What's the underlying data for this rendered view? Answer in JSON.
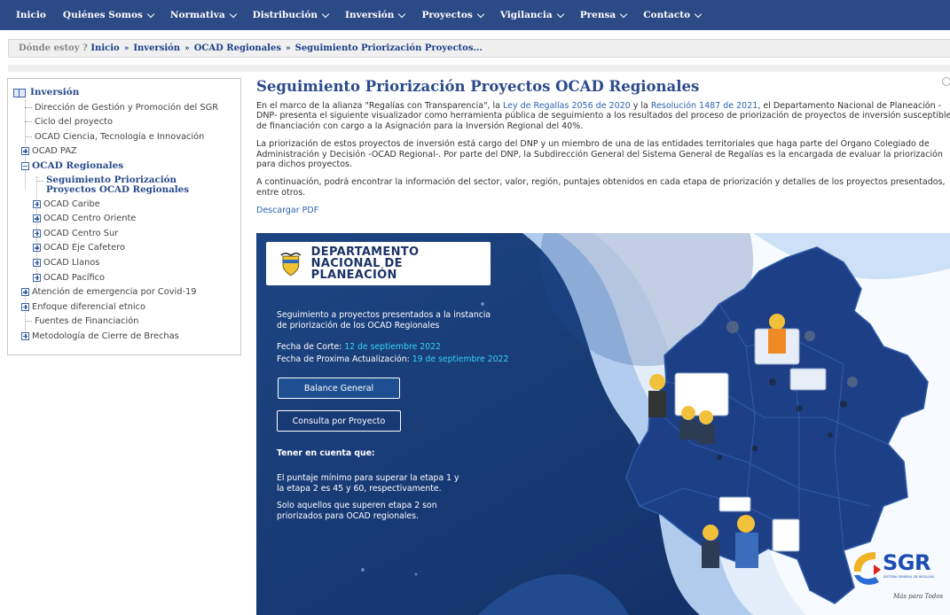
{
  "topnav": {
    "items": [
      {
        "label": "Inicio",
        "dropdown": false
      },
      {
        "label": "Quiénes Somos",
        "dropdown": true
      },
      {
        "label": "Normativa",
        "dropdown": true
      },
      {
        "label": "Distribución",
        "dropdown": true
      },
      {
        "label": "Inversión",
        "dropdown": true
      },
      {
        "label": "Proyectos",
        "dropdown": true
      },
      {
        "label": "Vigilancia",
        "dropdown": true
      },
      {
        "label": "Prensa",
        "dropdown": true
      },
      {
        "label": "Contacto",
        "dropdown": true
      }
    ],
    "bg_color": "#2b4a86"
  },
  "breadcrumb": {
    "prefix": "Dónde estoy ?",
    "items": [
      "Inicio",
      "Inversión",
      "OCAD Regionales",
      "Seguimiento Priorización Proyectos..."
    ]
  },
  "sidebar": {
    "root": "Inversión",
    "items": [
      {
        "label": "Dirección de Gestión y Promoción del SGR"
      },
      {
        "label": "Ciclo del proyecto"
      },
      {
        "label": "OCAD Ciencia, Tecnología e Innovación"
      },
      {
        "label": "OCAD PAZ"
      },
      {
        "label": "OCAD Regionales"
      },
      {
        "label": "Seguimiento Priorización Proyectos OCAD Regionales"
      },
      {
        "label": "OCAD Caribe"
      },
      {
        "label": "OCAD Centro Oriente"
      },
      {
        "label": "OCAD Centro Sur"
      },
      {
        "label": "OCAD Eje Cafetero"
      },
      {
        "label": "OCAD Llanos"
      },
      {
        "label": "OCAD Pacífico"
      },
      {
        "label": "Atención de emergencia por Covid-19"
      },
      {
        "label": "Enfoque diferencial etnico"
      },
      {
        "label": "Fuentes de Financiación"
      },
      {
        "label": "Metodología de Cierre de Brechas"
      }
    ]
  },
  "main": {
    "title": "Seguimiento Priorización Proyectos OCAD Regionales",
    "p1": {
      "a": "En el marco de la alianza \"Regalías con Transparencia\", la ",
      "link1": "Ley de Regalías 2056 de 2020",
      "b": " y la ",
      "link2": "Resolución 1487 de 2021",
      "c": ", el Departamento Nacional de Planeación -DNP- presenta el siguiente visualizador como herramienta pública de seguimiento a los resultados del proceso de priorización de proyectos de inversión susceptibles de financiación con cargo a la Asignación para la Inversión Regional del 40%."
    },
    "p2": "La priorización de estos proyectos de inversión está cargo del DNP y un miembro de una de las entidades territoriales que haga parte del Órgano Colegiado de Administración y Decisión -OCAD Regional-. Por parte del DNP, la Subdirección General del Sistema General de Regalías es la encargada de evaluar la priorización para dichos proyectos.",
    "p3": "A continuación, podrá encontrar la información del sector, valor, región, puntajes obtenidos en cada etapa de priorización y detalles de los proyectos presentados, entre otros.",
    "download": "Descargar PDF"
  },
  "banner": {
    "logo_line1": "DEPARTAMENTO",
    "logo_line2": "NACIONAL DE PLANEACIÓN",
    "intro": "Seguimiento a proyectos presentados a la instancia de priorización de los OCAD Regionales",
    "corte_label": "Fecha de Corte: ",
    "corte_value": "12 de septiembre 2022",
    "next_label": "Fecha de Proxima Actualización: ",
    "next_value": "19 de septiembre 2022",
    "btn1": "Balance General",
    "btn2": "Consulta por Proyecto",
    "note_title": "Tener en cuenta que:",
    "note1": "El puntaje mínimo para superar la etapa 1 y la etapa 2 es 45 y 60, respectivamente.",
    "note2": "Solo aquellos que superen etapa 2 son priorizados para OCAD regionales.",
    "sgr": "SGR",
    "sgr_sub": "SISTEMA GENERAL DE REGALÍAS",
    "sgr_slogan": "Más para Todos",
    "colors": {
      "bg": "#173a75",
      "highlight": "#33d3f5",
      "map": "#1d3f86"
    }
  }
}
